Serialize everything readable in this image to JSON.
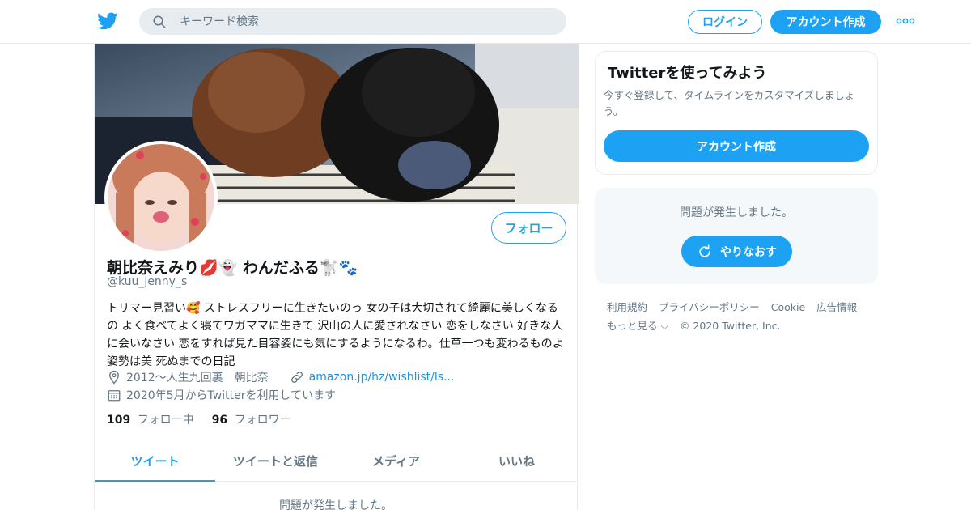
{
  "topbar": {
    "search_placeholder": "キーワード検索",
    "login_label": "ログイン",
    "signup_label": "アカウント作成"
  },
  "profile": {
    "display_name": "朝比奈えみり💋👻 わんだふる🐩🐾",
    "handle": "@kuu_jenny_s",
    "bio": "トリマー見習い🥰 ストレスフリーに生きたいのっ 女の子は大切されて綺麗に美しくなるの よく食べてよく寝てワガママに生きて 沢山の人に愛されなさい 恋をしなさい 好きな人に会いなさい 恋をすれば見た目容姿にも気にするようになるわ。仕草一つも変わるものよ 姿勢は美 死ぬまでの日記",
    "location": "2012〜人生九回裏　朝比奈",
    "website": "amazon.jp/hz/wishlist/ls...",
    "joined": "2020年5月からTwitterを利用しています",
    "following_count": "109",
    "following_label": "フォロー中",
    "followers_count": "96",
    "followers_label": "フォロワー",
    "follow_button": "フォロー"
  },
  "tabs": [
    {
      "label": "ツイート",
      "active": true
    },
    {
      "label": "ツイートと返信",
      "active": false
    },
    {
      "label": "メディア",
      "active": false
    },
    {
      "label": "いいね",
      "active": false
    }
  ],
  "timeline": {
    "error_text": "問題が発生しました。"
  },
  "sidebar": {
    "signup_card": {
      "title": "Twitterを使ってみよう",
      "description": "今すぐ登録して、タイムラインをカスタマイズしましょう。",
      "button": "アカウント作成"
    },
    "error_card": {
      "message": "問題が発生しました。",
      "retry_button": "やりなおす"
    },
    "footer": {
      "links": [
        "利用規約",
        "プライバシーポリシー",
        "Cookie",
        "広告情報",
        "もっと見る ⌵"
      ],
      "copyright": "© 2020 Twitter, Inc."
    }
  },
  "colors": {
    "accent": "#1da1f2",
    "secondary_text": "#657786",
    "border": "#e6ecf0"
  },
  "icons": [
    "twitter-bird-icon",
    "search-icon",
    "more-dots-icon",
    "location-icon",
    "link-icon",
    "calendar-icon",
    "refresh-icon"
  ]
}
